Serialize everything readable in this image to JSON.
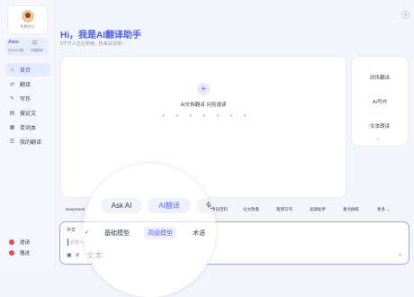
{
  "sidebar": {
    "logo_caption": "免费积分",
    "mini_tools": {
      "left_label": "Aiwo",
      "left_sub": "优化AI问题",
      "right_icon": "⊡",
      "right_sub": "快捷翻译"
    },
    "nav": [
      {
        "label": "首页",
        "icon": "⌂",
        "active": true
      },
      {
        "label": "翻译",
        "icon": "⇄",
        "active": false
      },
      {
        "label": "写作",
        "icon": "✎",
        "active": false
      },
      {
        "label": "搜论文",
        "icon": "▤",
        "active": false
      },
      {
        "label": "单词本",
        "icon": "▦",
        "active": false
      },
      {
        "label": "我的翻译",
        "icon": "☰",
        "active": false
      }
    ],
    "bottom": [
      {
        "label": "邀请",
        "color": "#e84a4a"
      },
      {
        "label": "赠送",
        "color": "#e84a4a"
      }
    ]
  },
  "header": {
    "greeting": "Hi，我是AI翻译助手",
    "subtitle": "5千万人正在使用，快来试试吧~"
  },
  "card": {
    "plus": "+",
    "caption": "AI文档翻译·问答速读",
    "formats": [
      "P",
      "P",
      "P",
      "P",
      "P",
      "P",
      "P"
    ]
  },
  "side_panel": {
    "items": [
      "同传翻译",
      "AI写作",
      "文本朗读"
    ],
    "chevron": "⌄"
  },
  "tools": {
    "items": [
      "DeepSeek",
      "多语翻译",
      "单词百科",
      "论文改重",
      "帮我写作",
      "润调助手",
      "重点摘练",
      "更多 ⌄"
    ]
  },
  "input": {
    "lang": "中文",
    "placeholder": "请输入你",
    "send": "➤"
  },
  "lens": {
    "tabs": [
      "Ask AI",
      "AI翻译",
      "句"
    ],
    "active_tab": "AI翻译",
    "models": [
      "基础模型",
      "高级模型",
      "术语"
    ],
    "selected_model": "高级模型",
    "placeholder": "文本"
  },
  "colors": {
    "accent": "#4b5de8",
    "border_focus": "#9aa6f5"
  }
}
